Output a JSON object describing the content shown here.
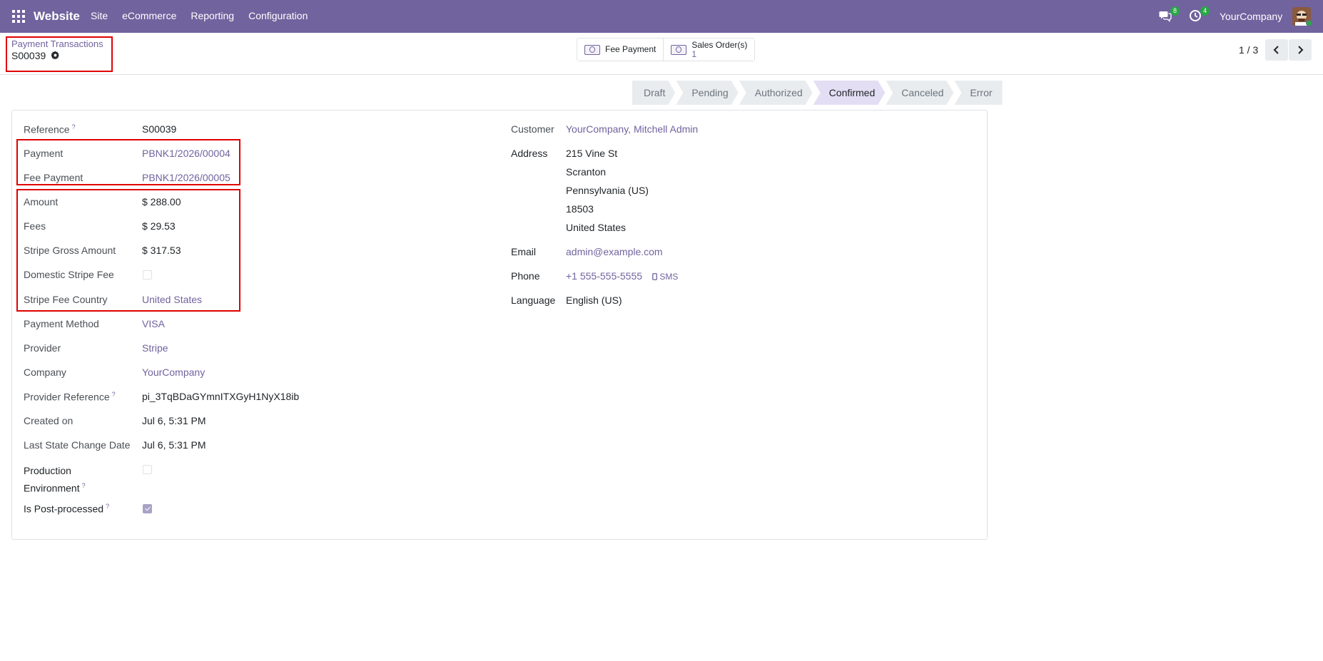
{
  "navbar": {
    "brand": "Website",
    "menu": [
      "Site",
      "eCommerce",
      "Reporting",
      "Configuration"
    ],
    "messages_badge": "8",
    "activities_badge": "4",
    "company": "YourCompany"
  },
  "control_panel": {
    "breadcrumb_parent": "Payment Transactions",
    "record_name": "S00039",
    "stat_fee_payment": "Fee Payment",
    "stat_sales_orders_label": "Sales Order(s)",
    "stat_sales_orders_value": "1",
    "pager": "1 / 3"
  },
  "statusbar": {
    "steps": [
      "Draft",
      "Pending",
      "Authorized",
      "Confirmed",
      "Canceled",
      "Error"
    ],
    "active": "Confirmed"
  },
  "form_left": {
    "reference_label": "Reference",
    "reference_value": "S00039",
    "payment_label": "Payment",
    "payment_value": "PBNK1/2026/00004",
    "fee_payment_label": "Fee Payment",
    "fee_payment_value": "PBNK1/2026/00005",
    "amount_label": "Amount",
    "amount_value": "$ 288.00",
    "fees_label": "Fees",
    "fees_value": "$ 29.53",
    "gross_label": "Stripe Gross Amount",
    "gross_value": "$ 317.53",
    "domestic_label": "Domestic Stripe Fee",
    "fee_country_label": "Stripe Fee Country",
    "fee_country_value": "United States",
    "method_label": "Payment Method",
    "method_value": "VISA",
    "provider_label": "Provider",
    "provider_value": "Stripe",
    "company_label": "Company",
    "company_value": "YourCompany",
    "provider_ref_label": "Provider Reference",
    "provider_ref_value": "pi_3TqBDaGYmnITXGyH1NyX18ib",
    "created_label": "Created on",
    "created_value": "Jul 6, 5:31 PM",
    "last_state_label": "Last State Change Date",
    "last_state_value": "Jul 6, 5:31 PM",
    "production_label_1": "Production",
    "production_label_2": "Environment",
    "post_processed_label": "Is Post-processed"
  },
  "form_right": {
    "customer_label": "Customer",
    "customer_value": "YourCompany, Mitchell Admin",
    "address_label": "Address",
    "address_lines": [
      "215 Vine St",
      "Scranton",
      "Pennsylvania (US)",
      "18503",
      "United States"
    ],
    "email_label": "Email",
    "email_value": "admin@example.com",
    "phone_label": "Phone",
    "phone_value": "+1 555-555-5555",
    "sms_label": "SMS",
    "language_label": "Language",
    "language_value": "English (US)"
  },
  "checkboxes": {
    "domestic_stripe_fee": false,
    "production_environment": false,
    "is_post_processed": true
  },
  "colors": {
    "navbar": "#71639e",
    "link": "#71639e",
    "highlight_box": "#e00000"
  }
}
